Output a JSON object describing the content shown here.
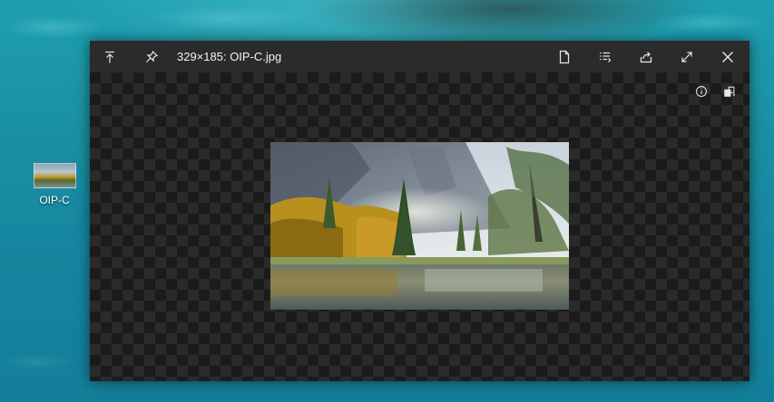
{
  "desktop": {
    "icon_label": "OIP-C"
  },
  "viewer": {
    "title": "329×185: OIP-C.jpg",
    "titlebar_buttons": [
      {
        "name": "pin-to-top-icon"
      },
      {
        "name": "pin-icon"
      },
      {
        "name": "file-icon"
      },
      {
        "name": "list-icon"
      },
      {
        "name": "share-icon"
      },
      {
        "name": "fullscreen-icon"
      },
      {
        "name": "close-icon"
      }
    ],
    "overlay_buttons": [
      {
        "name": "info-icon"
      },
      {
        "name": "rotate-icon"
      }
    ]
  },
  "colors": {
    "titlebar": "#2b2b2b",
    "checker_dark": "#1b1b1b",
    "checker_light": "#2a2a2a",
    "desktop": "#1a8fa3"
  }
}
